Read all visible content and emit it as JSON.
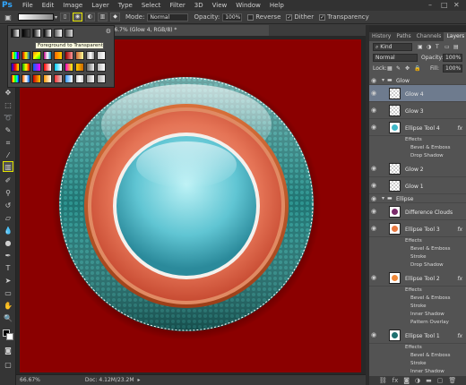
{
  "app": {
    "logo": "Ps"
  },
  "menubar": {
    "items": [
      "File",
      "Edit",
      "Image",
      "Layer",
      "Type",
      "Select",
      "Filter",
      "3D",
      "View",
      "Window",
      "Help"
    ]
  },
  "options": {
    "mode_label": "Mode:",
    "mode_value": "Normal",
    "opacity_label": "Opacity:",
    "opacity_value": "100%",
    "reverse_label": "Reverse",
    "dither_label": "Dither",
    "transparency_label": "Transparency"
  },
  "document": {
    "tab_title": "d @ 66.7% (Glow 4, RGB/8) *",
    "zoom": "66.67%",
    "doc_size": "Doc: 4.12M/23.2M"
  },
  "gradient_picker": {
    "tooltip": "Foreground to Transparent"
  },
  "panel": {
    "tabs": [
      "History",
      "Paths",
      "Channels",
      "Layers"
    ],
    "kind_label": "Kind",
    "blend_mode": "Normal",
    "opacity_label": "Opacity:",
    "opacity_value": "100%",
    "lock_label": "Lock:",
    "fill_label": "Fill:",
    "fill_value": "100%",
    "layers": [
      {
        "type": "group",
        "name": "Glow"
      },
      {
        "type": "layer",
        "name": "Glow 4",
        "selected": true
      },
      {
        "type": "layer",
        "name": "Glow 3"
      },
      {
        "type": "layer",
        "name": "Ellipse Tool 4",
        "fx": true,
        "thumb_color": "#40b8c8"
      },
      {
        "type": "effects",
        "label": "Effects"
      },
      {
        "type": "effect",
        "label": "Bevel & Emboss"
      },
      {
        "type": "effect",
        "label": "Drop Shadow"
      },
      {
        "type": "layer",
        "name": "Glow 2"
      },
      {
        "type": "layer",
        "name": "Glow 1"
      },
      {
        "type": "group",
        "name": "Ellipse"
      },
      {
        "type": "layer",
        "name": "Difference Clouds",
        "thumb_color": "#7a2a6a"
      },
      {
        "type": "layer",
        "name": "Ellipse Tool 3",
        "fx": true,
        "thumb_color": "#e87840"
      },
      {
        "type": "effects",
        "label": "Effects"
      },
      {
        "type": "effect",
        "label": "Bevel & Emboss"
      },
      {
        "type": "effect",
        "label": "Stroke"
      },
      {
        "type": "effect",
        "label": "Drop Shadow"
      },
      {
        "type": "layer",
        "name": "Ellipse Tool 2",
        "fx": true,
        "thumb_color": "#f08838"
      },
      {
        "type": "effects",
        "label": "Effects"
      },
      {
        "type": "effect",
        "label": "Bevel & Emboss"
      },
      {
        "type": "effect",
        "label": "Stroke"
      },
      {
        "type": "effect",
        "label": "Inner Shadow"
      },
      {
        "type": "effect",
        "label": "Pattern Overlay"
      },
      {
        "type": "layer",
        "name": "Ellipse Tool 1",
        "fx": true,
        "thumb_color": "#1e7070"
      },
      {
        "type": "effects",
        "label": "Effects"
      },
      {
        "type": "effect",
        "label": "Bevel & Emboss"
      },
      {
        "type": "effect",
        "label": "Stroke"
      },
      {
        "type": "effect",
        "label": "Inner Shadow"
      }
    ]
  },
  "colors": {
    "canvas_bg": "#8b0000",
    "accent": "#e4e400",
    "selected_layer": "#6e7b8e"
  }
}
